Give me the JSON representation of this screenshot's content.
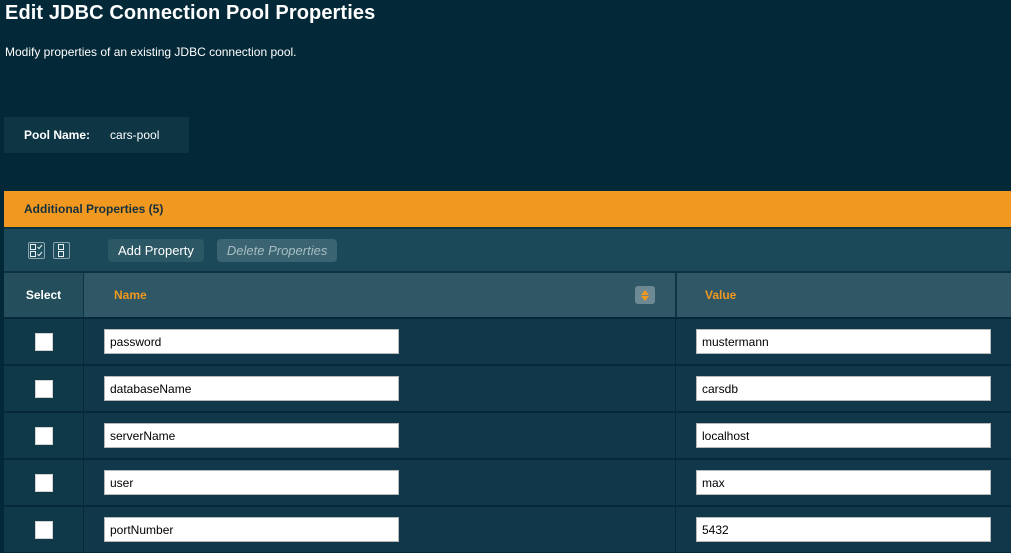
{
  "page": {
    "title": "Edit JDBC Connection Pool Properties",
    "description": "Modify properties of an existing JDBC connection pool."
  },
  "pool": {
    "label": "Pool Name:",
    "value": "cars-pool"
  },
  "table": {
    "caption": "Additional Properties (5)",
    "toolbar": {
      "select_all_icon": "select-all-icon",
      "deselect_all_icon": "deselect-all-icon",
      "add_label": "Add Property",
      "delete_label": "Delete Properties"
    },
    "headers": {
      "select": "Select",
      "name": "Name",
      "value": "Value"
    },
    "rows": [
      {
        "name": "password",
        "value": "mustermann"
      },
      {
        "name": "databaseName",
        "value": "carsdb"
      },
      {
        "name": "serverName",
        "value": "localhost"
      },
      {
        "name": "user",
        "value": "max"
      },
      {
        "name": "portNumber",
        "value": "5432"
      }
    ]
  },
  "colors": {
    "background": "#032838",
    "accent": "#f0981f",
    "toolbar": "#1c4959"
  }
}
